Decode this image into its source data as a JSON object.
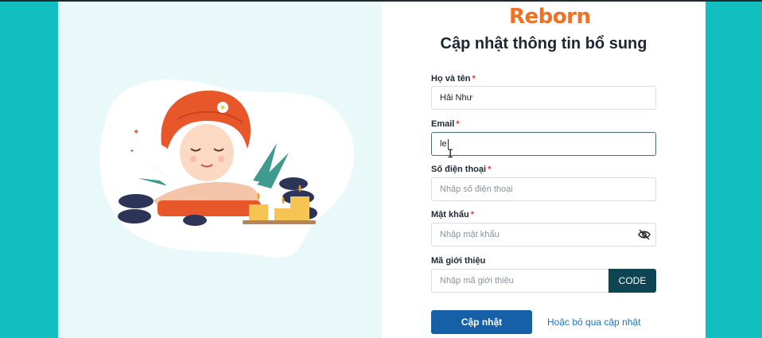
{
  "brand": {
    "logo_text": "Reborn",
    "brand_color": "#f36f21"
  },
  "page": {
    "title": "Cập nhật thông tin bổ sung"
  },
  "form": {
    "full_name": {
      "label": "Họ và tên",
      "required": "*",
      "value": "Hải Như"
    },
    "email": {
      "label": "Email",
      "required": "*",
      "value": "le"
    },
    "phone": {
      "label": "Số điện thoại",
      "required": "*",
      "placeholder": "Nhập số điện thoại"
    },
    "password": {
      "label": "Mật khẩu",
      "required": "*",
      "placeholder": "Nhập mật khẩu",
      "toggle_icon": "eye-off-icon"
    },
    "referral": {
      "label": "Mã giới thiệu",
      "placeholder": "Nhập mã giới thiệu",
      "code_button": "CODE"
    }
  },
  "actions": {
    "submit_label": "Cập nhật",
    "skip_label": "Hoặc bỏ qua cập nhật"
  },
  "colors": {
    "background": "#12bfc0",
    "primary": "#1660a8",
    "code_button": "#0d4552",
    "link": "#1a73c9"
  }
}
